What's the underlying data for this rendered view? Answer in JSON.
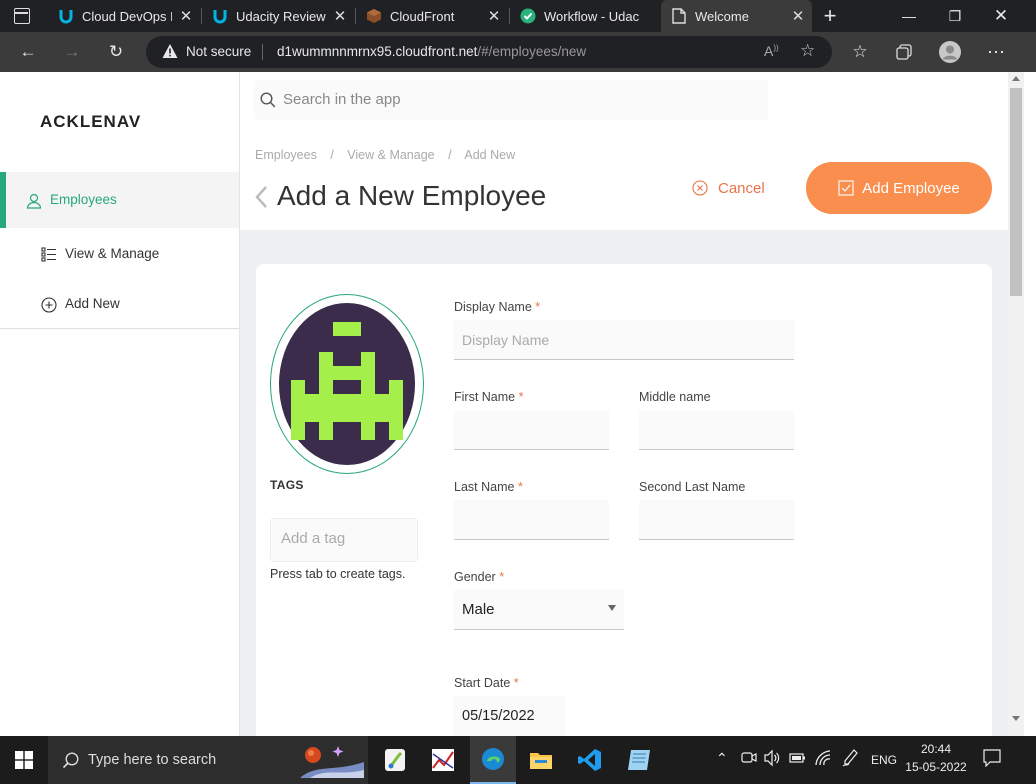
{
  "browser": {
    "tabs": [
      {
        "title": "Cloud DevOps En"
      },
      {
        "title": "Udacity Reviews"
      },
      {
        "title": "CloudFront"
      },
      {
        "title": "Workflow - Udac"
      },
      {
        "title": "Welcome"
      }
    ],
    "security_label": "Not secure",
    "url_host": "d1wummnnmrnx95.cloudfront.net",
    "url_path": "/#/employees/new"
  },
  "app": {
    "logo": "ACKLENAV",
    "search_placeholder": "Search in the app",
    "nav": [
      {
        "label": "Employees"
      },
      {
        "label": "View & Manage"
      },
      {
        "label": "Add New"
      }
    ],
    "breadcrumb": [
      "Employees",
      "View & Manage",
      "Add New"
    ],
    "breadcrumb_sep": "/",
    "page_title": "Add a New Employee",
    "cancel_label": "Cancel",
    "add_label": "Add Employee",
    "accent_color": "#f98e4f",
    "nav_active_color": "#27a87a"
  },
  "form": {
    "tags_heading": "TAGS",
    "tag_placeholder": "Add a tag",
    "tag_hint": "Press tab to create tags.",
    "display_name_label": "Display Name",
    "display_name_placeholder": "Display Name",
    "first_name_label": "First Name",
    "middle_name_label": "Middle name",
    "last_name_label": "Last Name",
    "second_last_name_label": "Second Last Name",
    "gender_label": "Gender",
    "gender_value": "Male",
    "start_date_label": "Start Date",
    "start_date_value": "05/15/2022",
    "required_mark": "*"
  },
  "taskbar": {
    "search_placeholder": "Type here to search",
    "language": "ENG",
    "time": "20:44",
    "date": "15-05-2022"
  }
}
